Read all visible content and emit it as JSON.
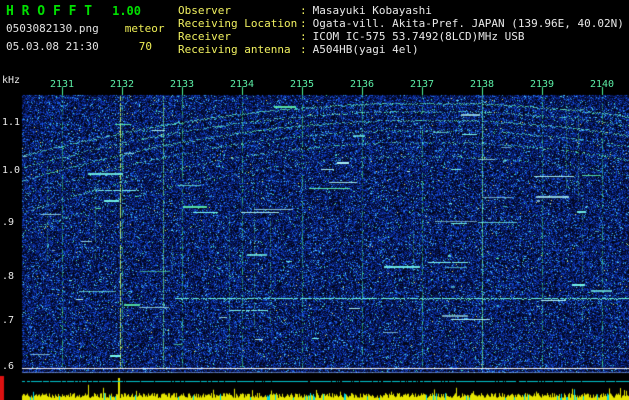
{
  "app": {
    "title_letters": "H R O F F T",
    "version": "1.00",
    "filename": "0503082130.png",
    "mode": "meteor",
    "datetime": "05.03.08 21:30",
    "count": "70"
  },
  "station": {
    "separator": ":",
    "rows": [
      {
        "label": "Observer",
        "value": "Masayuki Kobayashi"
      },
      {
        "label": "Receiving Location",
        "value": "Ogata-vill. Akita-Pref. JAPAN (139.96E, 40.02N)"
      },
      {
        "label": "Receiver",
        "value": "ICOM IC-575 53.7492(8LCD)MHz USB"
      },
      {
        "label": "Receiving antenna",
        "value": "A504HB(yagi 4el)"
      }
    ]
  },
  "axes": {
    "y_unit": "kHz",
    "y_ticks": [
      "1.1",
      "1.0",
      ".9",
      ".8",
      ".7",
      ".6"
    ],
    "x_ticks": [
      "2131",
      "2132",
      "2133",
      "2134",
      "2135",
      "2136",
      "2137",
      "2138",
      "2139",
      "2140"
    ]
  },
  "colors": {
    "title_green": "#00e000",
    "label_yellow": "#f0f060",
    "value_white": "#e8e8e8",
    "time_tick": "#5ceea6",
    "freq_label": "#e8e8e8",
    "noise_blue": "#0e38b4",
    "trace_cyan": "#6effe6",
    "bar_yellow": "#e6e600",
    "bar_cyan": "#00d9e6",
    "marker_red": "#dd1111",
    "background": "#000000"
  }
}
